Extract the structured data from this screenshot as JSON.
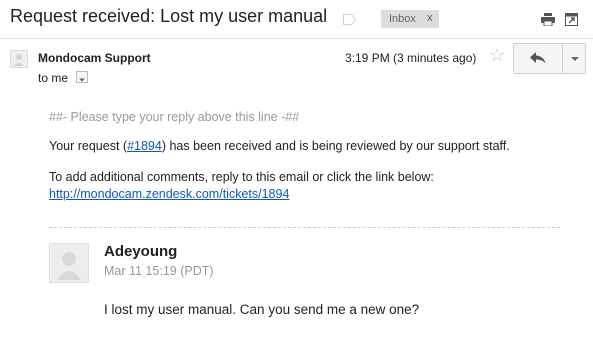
{
  "header": {
    "subject": "Request received: Lost my user manual",
    "label": {
      "name": "Inbox",
      "remove": "x"
    }
  },
  "message_header": {
    "sender": "Mondocam Support",
    "recipient": "to me",
    "time": "3:19 PM (3 minutes ago)"
  },
  "body": {
    "reply_line": "##- Please type your reply above this line -##",
    "para1_pre": "Your request (",
    "ticket_link": "#1894",
    "para1_post": ") has been received and is being reviewed by our support staff.",
    "para2": "To add additional comments, reply to this email or click the link below:",
    "url": "http://mondocam.zendesk.com/tickets/1894"
  },
  "comment": {
    "author": "Adeyoung",
    "date": "Mar 11 15:19 (PDT)",
    "text": "I lost my user manual. Can you send me a new one?"
  },
  "icons": {
    "label": "label-tag-icon",
    "print": "print-icon",
    "new_window": "new-window-icon",
    "star": "star-icon",
    "reply": "reply-icon",
    "more": "chevron-down-icon"
  },
  "colors": {
    "link": "#1155cc",
    "muted": "#999999",
    "chip_bg": "#dddddd"
  }
}
